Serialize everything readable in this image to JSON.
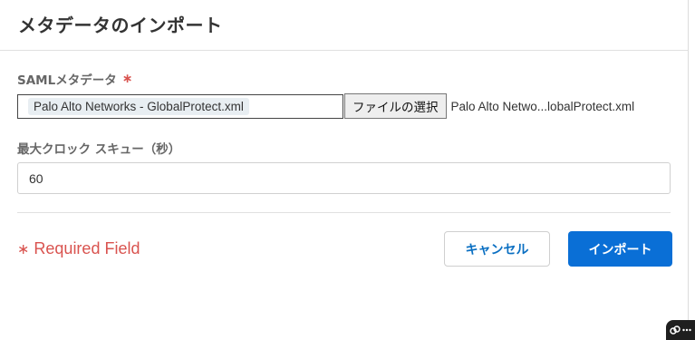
{
  "dialog": {
    "title": "メタデータのインポート"
  },
  "saml_field": {
    "label": "SAMLメタデータ",
    "required_mark": "∗",
    "selected_chip": "Palo Alto Networks - GlobalProtect.xml",
    "choose_button": "ファイルの選択",
    "file_name": "Palo Alto Netwo...lobalProtect.xml"
  },
  "clock_skew_field": {
    "label": "最大クロック スキュー（秒）",
    "value": "60"
  },
  "footer": {
    "required_star": "∗",
    "required_text": "Required Field",
    "cancel_label": "キャンセル",
    "import_label": "インポート"
  },
  "colors": {
    "primary": "#0a6fd6",
    "required": "#d9534f"
  },
  "icons": {
    "corner_widget": "link-icon",
    "corner_more": "more-icon"
  }
}
